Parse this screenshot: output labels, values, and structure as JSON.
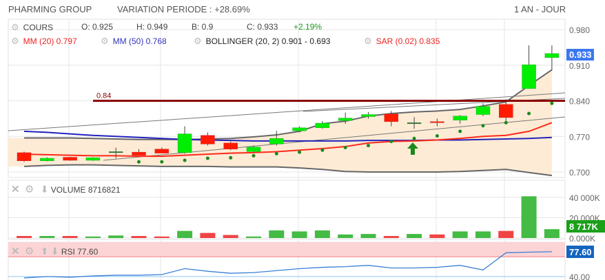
{
  "header": {
    "name": "PHARMING GROUP",
    "variation": "VARIATION PERIODE : +28.69%",
    "period": "1 AN - JOUR"
  },
  "legend": {
    "cours": "COURS",
    "open": "O: 0.925",
    "high": "H: 0.949",
    "low": "B: 0.9",
    "close": "C: 0.933",
    "change": "+2.19%",
    "mm20": "MM (20) 0.797",
    "mm50": "MM (50) 0.768",
    "bollinger": "BOLLINGER (20, 2) 0.901 - 0.693",
    "sar": "SAR (0.02) 0.835"
  },
  "colors": {
    "up": "#00ee00",
    "down": "#ff1a00",
    "mm20": "#ff2a1a",
    "mm50": "#2222bb",
    "support": "#8b0000",
    "last_price": "#3b78f0",
    "volume_badge": "#1aa01a",
    "rsi_badge": "#1565c0"
  },
  "chart_data": [
    {
      "type": "candlestick",
      "title": "COURS",
      "ylim": [
        0.685,
        0.995
      ],
      "y_ticks": [
        "0.980",
        "0.910",
        "0.840",
        "0.770",
        "0.700"
      ],
      "y_tick_values": [
        0.98,
        0.91,
        0.84,
        0.77,
        0.7
      ],
      "last_price_label": "0.933",
      "support_level": 0.84,
      "support_label": "0.84",
      "candles": [
        [
          0.738,
          0.74,
          0.72,
          0.722
        ],
        [
          0.722,
          0.729,
          0.721,
          0.727
        ],
        [
          0.729,
          0.73,
          0.722,
          0.723
        ],
        [
          0.723,
          0.729,
          0.722,
          0.728
        ],
        [
          0.74,
          0.748,
          0.727,
          0.74
        ],
        [
          0.739,
          0.745,
          0.733,
          0.733
        ],
        [
          0.745,
          0.748,
          0.737,
          0.737
        ],
        [
          0.738,
          0.79,
          0.736,
          0.775
        ],
        [
          0.772,
          0.778,
          0.752,
          0.755
        ],
        [
          0.757,
          0.76,
          0.743,
          0.745
        ],
        [
          0.74,
          0.752,
          0.738,
          0.749
        ],
        [
          0.755,
          0.781,
          0.752,
          0.766
        ],
        [
          0.781,
          0.79,
          0.778,
          0.787
        ],
        [
          0.787,
          0.8,
          0.785,
          0.796
        ],
        [
          0.801,
          0.817,
          0.795,
          0.806
        ],
        [
          0.809,
          0.818,
          0.805,
          0.813
        ],
        [
          0.814,
          0.82,
          0.79,
          0.799
        ],
        [
          0.797,
          0.808,
          0.785,
          0.797
        ],
        [
          0.799,
          0.805,
          0.79,
          0.797
        ],
        [
          0.802,
          0.812,
          0.795,
          0.81
        ],
        [
          0.813,
          0.835,
          0.81,
          0.829
        ],
        [
          0.833,
          0.843,
          0.795,
          0.807
        ],
        [
          0.864,
          0.949,
          0.864,
          0.911
        ],
        [
          0.925,
          0.949,
          0.9,
          0.933
        ]
      ],
      "mm20": [
        0.735,
        0.734,
        0.733,
        0.732,
        0.732,
        0.731,
        0.731,
        0.733,
        0.735,
        0.737,
        0.738,
        0.74,
        0.743,
        0.746,
        0.75,
        0.757,
        0.76,
        0.761,
        0.763,
        0.766,
        0.77,
        0.772,
        0.78,
        0.797
      ],
      "mm50": [
        0.78,
        0.778,
        0.775,
        0.772,
        0.77,
        0.768,
        0.766,
        0.764,
        0.763,
        0.762,
        0.761,
        0.761,
        0.761,
        0.761,
        0.761,
        0.762,
        0.762,
        0.762,
        0.763,
        0.763,
        0.764,
        0.765,
        0.766,
        0.768
      ],
      "bb_upper": [
        0.767,
        0.767,
        0.767,
        0.766,
        0.765,
        0.764,
        0.764,
        0.764,
        0.765,
        0.766,
        0.769,
        0.773,
        0.78,
        0.795,
        0.8,
        0.81,
        0.815,
        0.818,
        0.82,
        0.823,
        0.83,
        0.838,
        0.87,
        0.901
      ],
      "bb_lower": [
        0.711,
        0.713,
        0.714,
        0.714,
        0.713,
        0.712,
        0.711,
        0.711,
        0.711,
        0.71,
        0.71,
        0.71,
        0.708,
        0.705,
        0.701,
        0.7,
        0.7,
        0.7,
        0.7,
        0.701,
        0.703,
        0.705,
        0.699,
        0.693
      ],
      "sar": [
        null,
        null,
        null,
        null,
        null,
        0.72,
        0.72,
        0.723,
        0.727,
        0.728,
        0.732,
        0.736,
        0.739,
        0.743,
        0.748,
        0.752,
        0.76,
        0.766,
        0.771,
        0.78,
        0.791,
        0.797,
        0.815,
        0.835
      ]
    },
    {
      "type": "bar",
      "title": "VOLUME",
      "value_label": "8716821",
      "ylim": [
        0,
        46000
      ],
      "y_ticks": [
        "40 000K",
        "20 000K",
        "0.000K"
      ],
      "y_tick_values": [
        40000,
        20000,
        0
      ],
      "last_label": "8 717K",
      "values": [
        2000,
        2000,
        2000,
        1500,
        2500,
        2000,
        1500,
        7000,
        5000,
        3000,
        1500,
        7500,
        6500,
        7500,
        3500,
        4000,
        2000,
        4000,
        3500,
        6500,
        6500,
        7000,
        41000,
        8717
      ]
    },
    {
      "type": "line",
      "title": "RSI",
      "value_label": "77.60",
      "ylim": [
        36,
        94
      ],
      "overbought": 70,
      "y_ticks": [
        "40.00"
      ],
      "y_tick_values": [
        40
      ],
      "last_label": "77.60",
      "values": [
        38,
        40,
        39,
        41,
        42,
        42,
        43,
        52,
        48,
        45,
        46,
        49,
        52,
        54,
        55,
        57,
        53,
        53,
        54,
        57,
        50,
        76,
        77,
        77.6
      ]
    }
  ]
}
